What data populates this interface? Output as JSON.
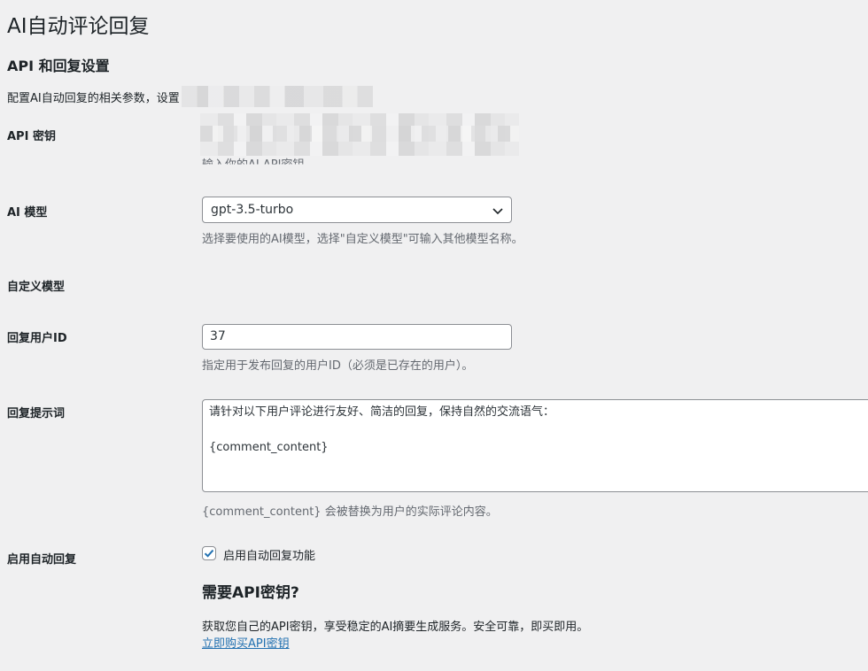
{
  "page": {
    "title": "AI自动评论回复"
  },
  "section": {
    "title": "API 和回复设置",
    "description": "配置AI自动回复的相关参数，设置"
  },
  "fields": {
    "api_key": {
      "label": "API 密钥",
      "hint": "输入你的AI API密钥。"
    },
    "model": {
      "label": "AI 模型",
      "selected": "gpt-3.5-turbo",
      "hint": "选择要使用的AI模型，选择\"自定义模型\"可输入其他模型名称。"
    },
    "custom_model": {
      "label": "自定义模型"
    },
    "reply_user_id": {
      "label": "回复用户ID",
      "value": "37",
      "hint": "指定用于发布回复的用户ID（必须是已存在的用户）。"
    },
    "reply_prompt": {
      "label": "回复提示词",
      "value": "请针对以下用户评论进行友好、简洁的回复，保持自然的交流语气：\n\n{comment_content}",
      "hint": "{comment_content} 会被替换为用户的实际评论内容。"
    },
    "auto_reply": {
      "label": "启用自动回复",
      "checkbox_label": "启用自动回复功能",
      "checked": true
    }
  },
  "promo": {
    "title": "需要API密钥?",
    "text": "获取您自己的API密钥，享受稳定的AI摘要生成服务。安全可靠，即买即用。",
    "link": "立即购买API密钥"
  },
  "colors": {
    "background": "#f0f0f1",
    "link": "#2271b1",
    "hint": "#646970",
    "checkbox": "#2271b1"
  }
}
